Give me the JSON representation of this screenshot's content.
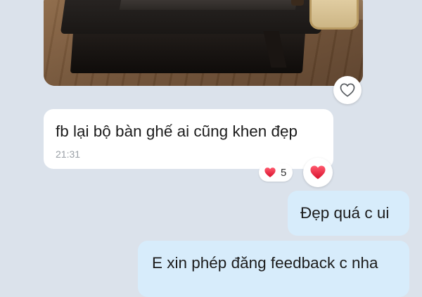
{
  "messages": {
    "photo": {
      "icon": "photo-attachment",
      "like_icon": "heart-outline-icon"
    },
    "received": {
      "text": "fb lại bộ bàn ghế ai cũng khen đẹp",
      "time": "21:31",
      "reactions": {
        "icon": "heart-filled-icon",
        "count": "5",
        "my_reaction_icon": "heart-filled-icon"
      }
    },
    "sent": [
      {
        "text": "Đẹp quá c ui"
      },
      {
        "text": "E xin phép đăng feedback c nha"
      }
    ]
  },
  "colors": {
    "background": "#dbe2eb",
    "received_bubble": "#ffffff",
    "sent_bubble": "#d7ecfb",
    "heart": "#e5213a",
    "time": "#9aa0a6"
  }
}
